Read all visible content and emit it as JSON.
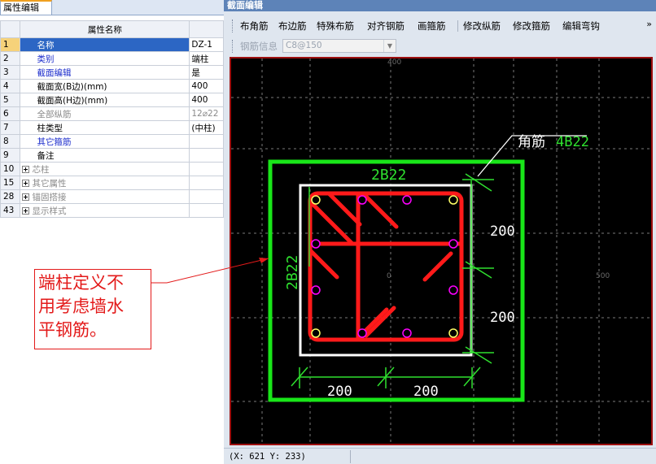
{
  "left_panel": {
    "tab_label": "属性编辑",
    "header_name": "属性名称",
    "rows": [
      {
        "num": "1",
        "name": "名称",
        "value": "DZ-1",
        "style": "selected"
      },
      {
        "num": "2",
        "name": "类别",
        "value": "端柱",
        "style": "blue"
      },
      {
        "num": "3",
        "name": "截面编辑",
        "value": "是",
        "style": "blue"
      },
      {
        "num": "4",
        "name": "截面宽(B边)(mm)",
        "value": "400",
        "style": "black"
      },
      {
        "num": "5",
        "name": "截面高(H边)(mm)",
        "value": "400",
        "style": "black"
      },
      {
        "num": "6",
        "name": "全部纵筋",
        "value": "12⌀22",
        "style": "gray"
      },
      {
        "num": "7",
        "name": "柱类型",
        "value": "(中柱)",
        "style": "black"
      },
      {
        "num": "8",
        "name": "其它箍筋",
        "value": "",
        "style": "blue"
      },
      {
        "num": "9",
        "name": "备注",
        "value": "",
        "style": "black"
      },
      {
        "num": "10",
        "name": "芯柱",
        "value": "",
        "style": "group"
      },
      {
        "num": "15",
        "name": "其它属性",
        "value": "",
        "style": "group"
      },
      {
        "num": "28",
        "name": "锚固搭接",
        "value": "",
        "style": "group"
      },
      {
        "num": "43",
        "name": "显示样式",
        "value": "",
        "style": "group"
      }
    ]
  },
  "annotation": {
    "lines": [
      "端柱定义不",
      "用考虑墙水",
      "平钢筋。"
    ]
  },
  "editor": {
    "title": "截面编辑",
    "toolbar": [
      "布角筋",
      "布边筋",
      "特殊布筋",
      "对齐钢筋",
      "画箍筋",
      "修改纵筋",
      "修改箍筋",
      "编辑弯钩"
    ],
    "more": "»",
    "rebar_info_label": "钢筋信息",
    "rebar_info_value": "C8@150",
    "status_coords": "(X: 621 Y: 233)"
  },
  "drawing": {
    "top_label": "2B22",
    "left_label": "2B22",
    "corner_label": "角筋",
    "corner_value": "4B22",
    "dim_right_top": "200",
    "dim_right_bottom": "200",
    "dim_bottom_left": "200",
    "dim_bottom_right": "200",
    "axis_top": "400",
    "axis_right": "500",
    "axis_center": "0",
    "colors": {
      "canvas": "#000000",
      "boundary": "#19e619",
      "section": "#ffffff",
      "stirrup": "#ff1a1a",
      "dimension": "#2fe02f",
      "bar_corner": "#ffff66",
      "bar_edge": "#ff00ff",
      "frame": "#9e1010"
    }
  }
}
